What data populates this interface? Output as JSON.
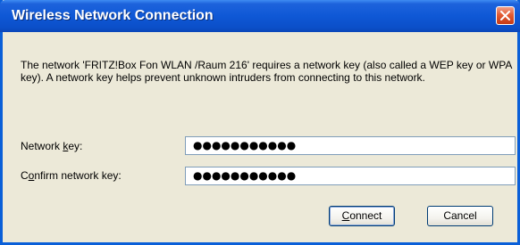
{
  "dialog": {
    "title": "Wireless Network Connection",
    "message": "The network 'FRITZ!Box Fon WLAN /Raum 216' requires a network key (also called a WEP key or WPA key). A network key helps prevent unknown intruders from connecting to this network.",
    "network_key": {
      "label_pre": "Network ",
      "label_hotkey": "k",
      "label_post": "ey:",
      "value_masked": "●●●●●●●●●●●"
    },
    "confirm_key": {
      "label_pre": "C",
      "label_hotkey": "o",
      "label_post": "nfirm network key:",
      "value_masked": "●●●●●●●●●●●"
    },
    "buttons": {
      "connect_hotkey": "C",
      "connect_rest": "onnect",
      "cancel": "Cancel"
    }
  },
  "colors": {
    "titlebar": "#0f58d6",
    "dialog_bg": "#ece9d8",
    "close_button": "#e35b34"
  },
  "icons": {
    "close": "close-icon"
  }
}
